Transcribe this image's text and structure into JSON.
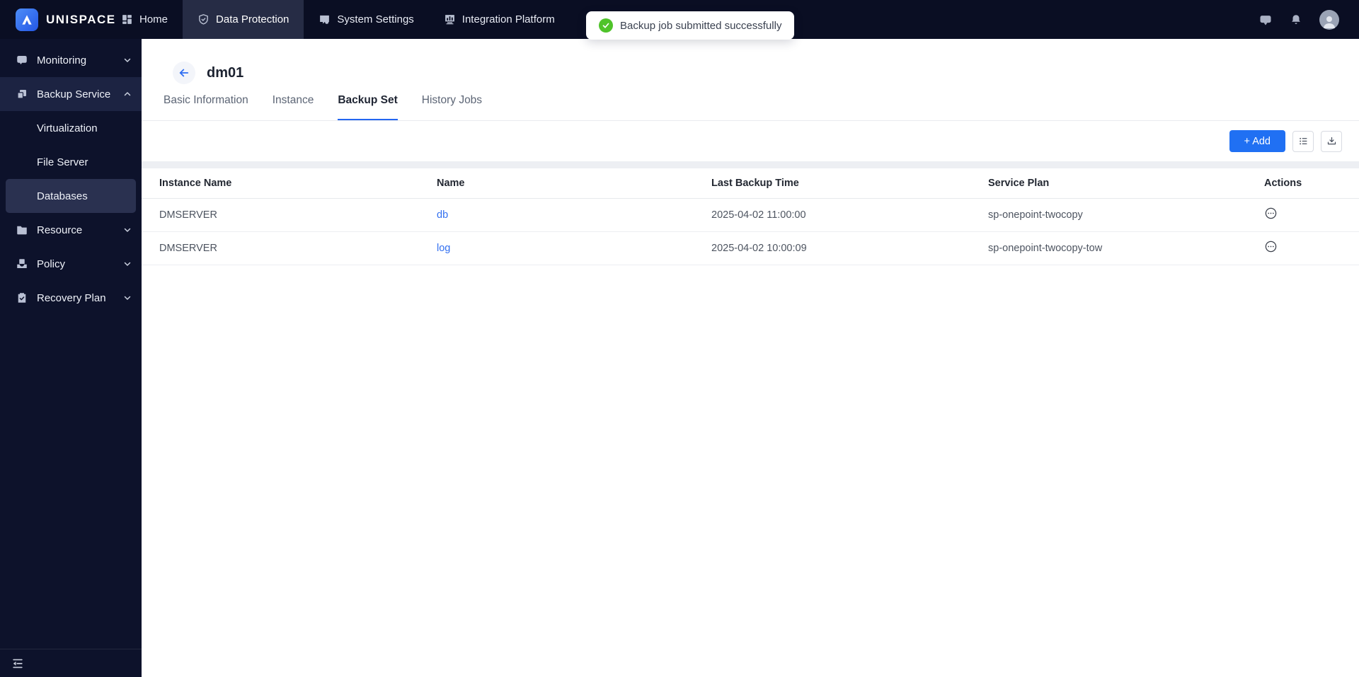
{
  "brand": {
    "name": "UNISPACE"
  },
  "topnav": {
    "items": [
      {
        "label": "Home",
        "icon": "grid-icon",
        "active": false
      },
      {
        "label": "Data Protection",
        "icon": "shield-icon",
        "active": true
      },
      {
        "label": "System Settings",
        "icon": "display-icon",
        "active": false
      },
      {
        "label": "Integration Platform",
        "icon": "bar-chart-icon",
        "active": false
      }
    ],
    "right_icons": [
      "feedback-icon",
      "bell-icon",
      "avatar"
    ]
  },
  "toast": {
    "message": "Backup job submitted successfully",
    "status": "success",
    "status_color": "#4fc32a"
  },
  "sidebar": {
    "items": [
      {
        "label": "Monitoring",
        "icon": "chat-icon",
        "chevron": "down"
      },
      {
        "label": "Backup Service",
        "icon": "copy-icon",
        "chevron": "up",
        "expanded": true
      },
      {
        "label": "Virtualization",
        "sub_item": true
      },
      {
        "label": "File Server",
        "sub_item": true
      },
      {
        "label": "Databases",
        "sub_item": true,
        "selected": true
      },
      {
        "label": "Resource",
        "icon": "folder-icon",
        "chevron": "down"
      },
      {
        "label": "Policy",
        "icon": "archive-icon",
        "chevron": "down"
      },
      {
        "label": "Recovery Plan",
        "icon": "clipboard-check-icon",
        "chevron": "down"
      }
    ]
  },
  "page": {
    "title": "dm01",
    "tabs": [
      {
        "label": "Basic Information",
        "active": false
      },
      {
        "label": "Instance",
        "active": false
      },
      {
        "label": "Backup Set",
        "active": true
      },
      {
        "label": "History Jobs",
        "active": false
      }
    ],
    "toolbar": {
      "add_label": "+ Add",
      "icon_buttons": [
        "list-settings-icon",
        "download-icon"
      ]
    }
  },
  "table": {
    "columns": [
      "Instance Name",
      "Name",
      "Last Backup Time",
      "Service Plan",
      "Actions"
    ],
    "rows": [
      {
        "instance_name": "DMSERVER",
        "name": "db",
        "last_backup_time": "2025-04-02 11:00:00",
        "service_plan": "sp-onepoint-twocopy"
      },
      {
        "instance_name": "DMSERVER",
        "name": "log",
        "last_backup_time": "2025-04-02 10:00:09",
        "service_plan": "sp-onepoint-twocopy-tow"
      }
    ]
  },
  "colors": {
    "navbar_bg": "#0a0e23",
    "sidebar_bg": "#0d122b",
    "accent_blue": "#2070f3",
    "link_blue": "#3370f0",
    "tab_underline": "#2366f0",
    "toast_green": "#4fc32a"
  }
}
